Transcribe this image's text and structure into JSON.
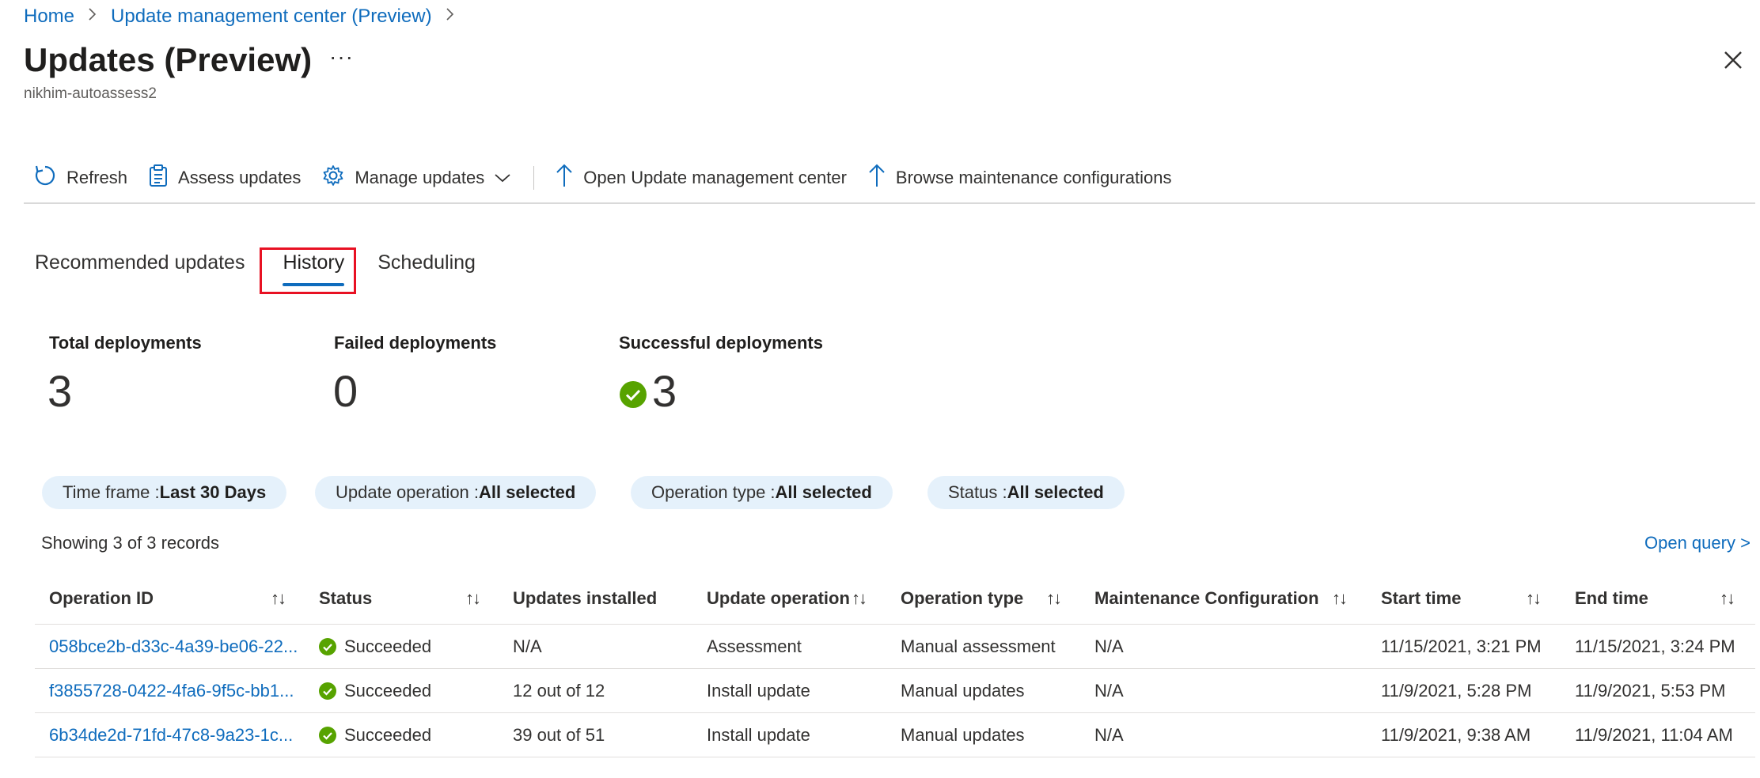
{
  "breadcrumb": [
    "Home",
    "Update management center (Preview)"
  ],
  "title": "Updates (Preview)",
  "more": "···",
  "subtitle": "nikhim-autoassess2",
  "toolbar": {
    "refresh": "Refresh",
    "assess": "Assess updates",
    "manage": "Manage updates",
    "open_umc": "Open Update management center",
    "browse": "Browse maintenance configurations"
  },
  "tabs": [
    "Recommended updates",
    "History",
    "Scheduling"
  ],
  "active_tab": "History",
  "summary": {
    "total_label": "Total deployments",
    "total_value": "3",
    "failed_label": "Failed deployments",
    "failed_value": "0",
    "success_label": "Successful deployments",
    "success_value": "3"
  },
  "filters": [
    {
      "key": "Time frame : ",
      "value": "Last 30 Days"
    },
    {
      "key": "Update operation : ",
      "value": "All selected"
    },
    {
      "key": "Operation type : ",
      "value": "All selected"
    },
    {
      "key": "Status : ",
      "value": "All selected"
    }
  ],
  "records_text": "Showing 3 of 3 records",
  "open_query": "Open query >",
  "table": {
    "columns": [
      "Operation ID",
      "Status",
      "Updates installed",
      "Update operation",
      "Operation type",
      "Maintenance Configuration",
      "Start time",
      "End time"
    ],
    "rows": [
      [
        "058bce2b-d33c-4a39-be06-22...",
        "Succeeded",
        "N/A",
        "Assessment",
        "Manual assessment",
        "N/A",
        "11/15/2021, 3:21 PM",
        "11/15/2021, 3:24 PM"
      ],
      [
        "f3855728-0422-4fa6-9f5c-bb1...",
        "Succeeded",
        "12 out of 12",
        "Install update",
        "Manual updates",
        "N/A",
        "11/9/2021, 5:28 PM",
        "11/9/2021, 5:53 PM"
      ],
      [
        "6b34de2d-71fd-47c8-9a23-1c...",
        "Succeeded",
        "39 out of 51",
        "Install update",
        "Manual updates",
        "N/A",
        "11/9/2021, 9:38 AM",
        "11/9/2021, 11:04 AM"
      ]
    ]
  },
  "colors": {
    "accent": "#0f6cbd",
    "success": "#57a300",
    "highlight": "#e81123",
    "pill": "#e5f1fb"
  }
}
